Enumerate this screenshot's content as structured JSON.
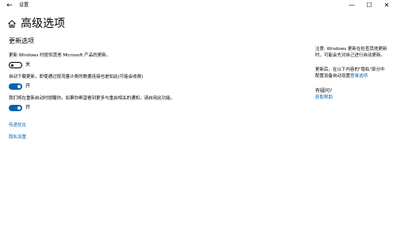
{
  "window": {
    "back_glyph": "←",
    "title": "设置",
    "minimize_glyph": "—",
    "maximize_glyph": "☐",
    "close_glyph": "✕"
  },
  "header": {
    "title": "高级选项"
  },
  "update_options": {
    "heading": "更新选项",
    "options": [
      {
        "label": "更新 Windows 时提供其他 Microsoft 产品的更新。",
        "state": "关",
        "on": false
      },
      {
        "label": "自动下载更新，即使通过按流量计费的数据连接也是如此(可能会收费)",
        "state": "开",
        "on": true
      },
      {
        "label": "我们将在重新启动时提醒你。如果你希望看到更多与重启相关的通知，请启用此功能。",
        "state": "开",
        "on": true
      }
    ]
  },
  "links": {
    "delivery_optimization": "传递优化",
    "privacy_settings": "隐私设置"
  },
  "sidebar": {
    "note_line1": "注意: Windows 更新在检查其他更新",
    "note_line2": "时，可能会先对自己进行自动更新。",
    "privacy_line1": "更新后，在以下内容的\"隐私\"部分中",
    "privacy_line2_prefix": "配置设备自动设置",
    "privacy_link": "登录选项",
    "question_heading": "有疑问?",
    "help_link": "获取帮助"
  },
  "colors": {
    "accent": "#0063b1"
  }
}
